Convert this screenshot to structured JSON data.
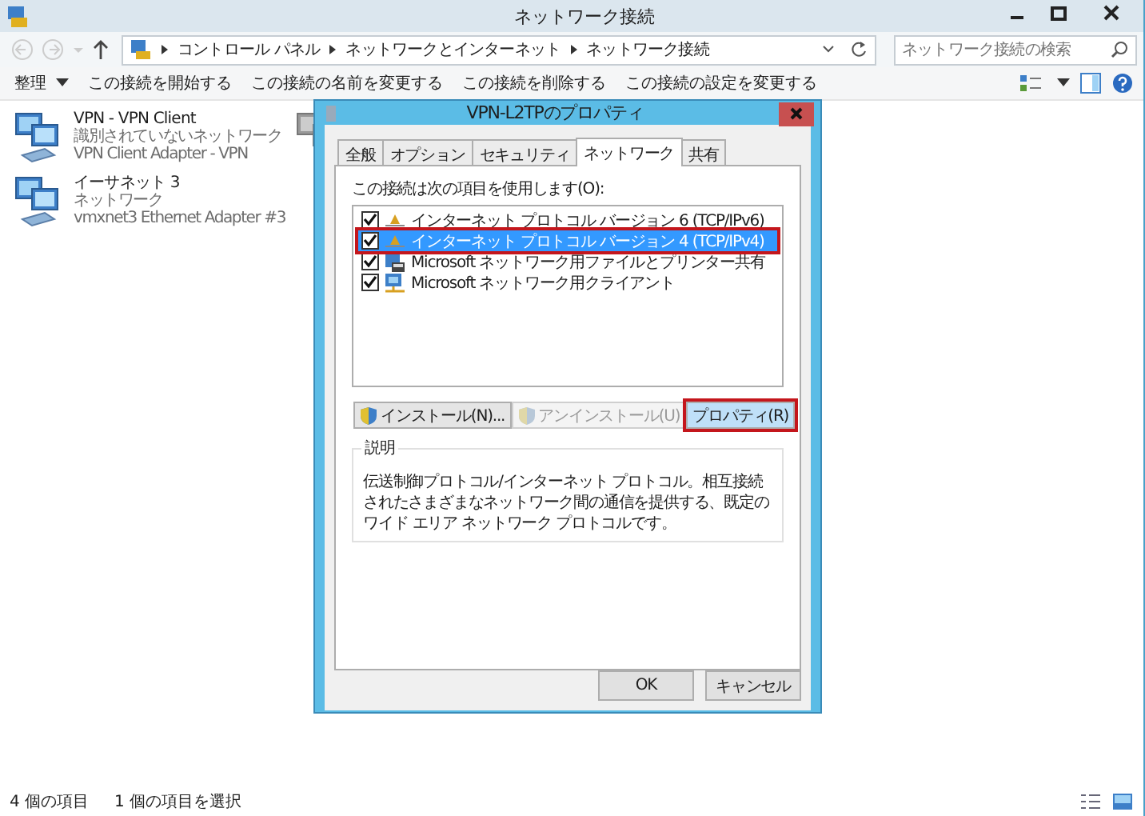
{
  "window": {
    "title": "ネットワーク接続"
  },
  "address": {
    "breadcrumbs": [
      "コントロール パネル",
      "ネットワークとインターネット",
      "ネットワーク接続"
    ],
    "search_placeholder": "ネットワーク接続の検索"
  },
  "toolbar": {
    "items": [
      {
        "label": "整理",
        "dropdown": true
      },
      {
        "label": "この接続を開始する",
        "dropdown": false
      },
      {
        "label": "この接続の名前を変更する",
        "dropdown": false
      },
      {
        "label": "この接続を削除する",
        "dropdown": false
      },
      {
        "label": "この接続の設定を変更する",
        "dropdown": false
      }
    ]
  },
  "connections": [
    {
      "name": "VPN - VPN Client",
      "status": "識別されていないネットワーク",
      "adapter": "VPN Client Adapter - VPN"
    },
    {
      "name": "イーサネット 3",
      "status": "ネットワーク",
      "adapter": "vmxnet3 Ethernet Adapter #3"
    }
  ],
  "dialog": {
    "title": "VPN-L2TPのプロパティ",
    "tabs": [
      {
        "label": "全般",
        "selected": false
      },
      {
        "label": "オプション",
        "selected": false
      },
      {
        "label": "セキュリティ",
        "selected": false
      },
      {
        "label": "ネットワーク",
        "selected": true
      },
      {
        "label": "共有",
        "selected": false
      }
    ],
    "list_label": "この接続は次の項目を使用します(O):",
    "items": [
      {
        "label": "インターネット プロトコル バージョン 6 (TCP/IPv6)",
        "kind": "protocol",
        "checked": true,
        "selected": false,
        "highlighted": false
      },
      {
        "label": "インターネット プロトコル バージョン 4 (TCP/IPv4)",
        "kind": "protocol",
        "checked": true,
        "selected": true,
        "highlighted": true
      },
      {
        "label": "Microsoft ネットワーク用ファイルとプリンター共有",
        "kind": "service",
        "checked": true,
        "selected": false,
        "highlighted": false
      },
      {
        "label": "Microsoft ネットワーク用クライアント",
        "kind": "client",
        "checked": true,
        "selected": false,
        "highlighted": false
      }
    ],
    "item_buttons": [
      {
        "label": "インストール(N)...",
        "shield": true,
        "disabled": false,
        "highlighted": false
      },
      {
        "label": "アンインストール(U)",
        "shield": true,
        "disabled": true,
        "highlighted": false
      },
      {
        "label": "プロパティ(R)",
        "shield": false,
        "disabled": false,
        "highlighted": true
      }
    ],
    "description_title": "説明",
    "description": "伝送制御プロトコル/インターネット プロトコル。相互接続されたさまざまなネットワーク間の通信を提供する、既定のワイド エリア ネットワーク プロトコルです。",
    "footer_buttons": [
      "OK",
      "キャンセル"
    ]
  },
  "status_bar": {
    "item_count": "4 個の項目",
    "selection": "1 個の項目を選択"
  }
}
